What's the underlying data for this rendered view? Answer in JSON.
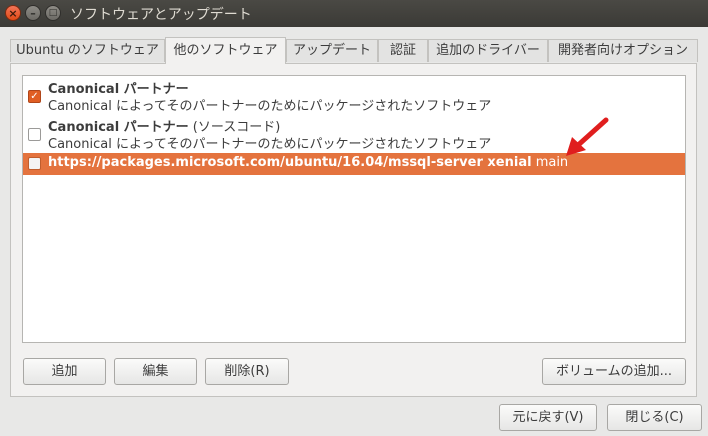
{
  "window": {
    "title": "ソフトウェアとアップデート",
    "close_glyph": "×",
    "min_glyph": "–",
    "max_glyph": "□"
  },
  "tabs": [
    {
      "label": "Ubuntu のソフトウェア",
      "active": false
    },
    {
      "label": "他のソフトウェア",
      "active": true
    },
    {
      "label": "アップデート",
      "active": false
    },
    {
      "label": "認証",
      "active": false
    },
    {
      "label": "追加のドライバー",
      "active": false
    },
    {
      "label": "開発者向けオプション",
      "active": false
    }
  ],
  "sources": [
    {
      "checked": true,
      "title": "Canonical パートナー",
      "title_suffix": "",
      "description": "Canonical によってそのパートナーのためにパッケージされたソフトウェア"
    },
    {
      "checked": false,
      "title": "Canonical パートナー",
      "title_suffix": " (ソースコード)",
      "description": "Canonical によってそのパートナーのためにパッケージされたソフトウェア"
    },
    {
      "checked": false,
      "selected": true,
      "title": "https://packages.microsoft.com/ubuntu/16.04/mssql-server xenial",
      "title_suffix": " main"
    }
  ],
  "buttons": {
    "add": "追加",
    "edit": "編集",
    "remove": "削除(R)",
    "add_volume": "ボリュームの追加...",
    "revert": "元に戻す(V)",
    "close": "閉じる(C)"
  },
  "colors": {
    "selection": "#e4733e",
    "checkbox_checked": "#e05e23",
    "annotation_arrow": "#e01e1e"
  },
  "icons": {
    "annotation": "red-arrow-icon",
    "check": "checkmark-icon"
  }
}
